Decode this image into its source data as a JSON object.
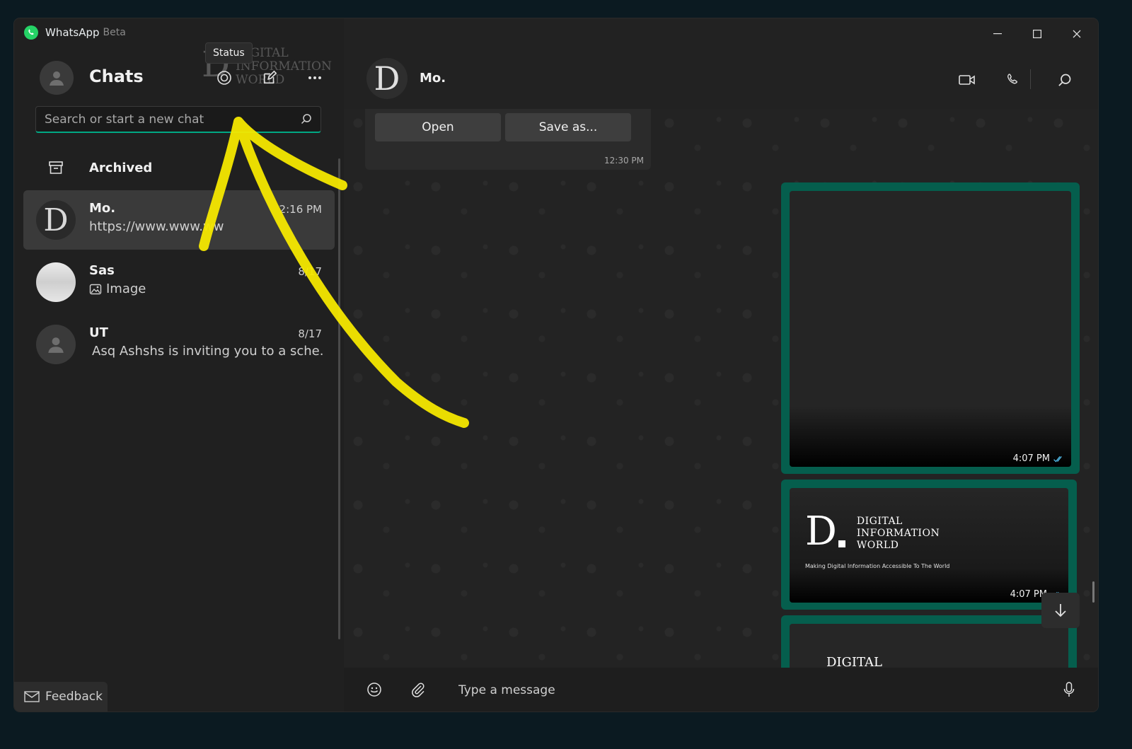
{
  "app": {
    "title": "WhatsApp",
    "badge": "Beta"
  },
  "left": {
    "header_title": "Chats",
    "tooltip": "Status",
    "search_placeholder": "Search or start a new chat",
    "archived_label": "Archived",
    "chats": [
      {
        "name": "Mo.",
        "time": "2:16 PM",
        "preview": "https://www.www.ww",
        "avatar": "D"
      },
      {
        "name": "Sas",
        "time": "8/17",
        "preview": "Image"
      },
      {
        "name": "UT",
        "time": "8/17",
        "preview": "Asq Ashshs is inviting you to a sche..."
      }
    ],
    "feedback_label": "Feedback"
  },
  "watermark": {
    "letter": "D",
    "lines": [
      "DIGITAL",
      "INFORMATION",
      "WORLD"
    ]
  },
  "conversation": {
    "contact_name": "Mo.",
    "contact_avatar": "D",
    "file_buttons": {
      "open": "Open",
      "save": "Save as..."
    },
    "file_time": "12:30 PM",
    "media": [
      {
        "time": "4:07 PM"
      },
      {
        "time": "4:07 PM",
        "logo_letter": "D",
        "logo_lines": [
          "DIGITAL",
          "INFORMATION",
          "WORLD"
        ],
        "tagline": "Making Digital Information Accessible To The World"
      },
      {
        "partial_text": "DIGITAL"
      }
    ],
    "compose_placeholder": "Type a message"
  },
  "colors": {
    "accent": "#00a884",
    "media_border": "#055e4d",
    "read_tick": "#53bdeb",
    "annotation": "#f5e800"
  }
}
